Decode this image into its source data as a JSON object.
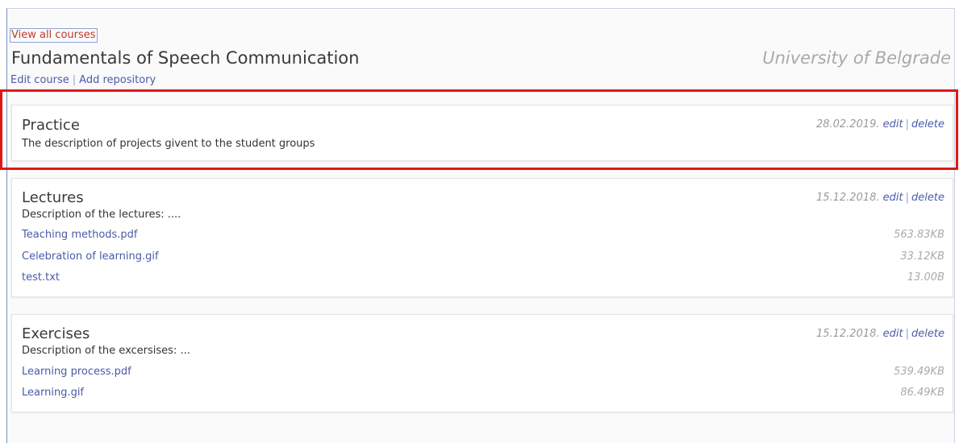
{
  "header": {
    "view_all_label": "View all courses",
    "course_title": "Fundamentals of Speech Communication",
    "university": "University of Belgrade",
    "edit_course_label": "Edit course",
    "add_repository_label": "Add repository",
    "separator": "|"
  },
  "repositories": [
    {
      "title": "Practice",
      "description": "The description of projects givent to the student groups",
      "date": "28.02.2019.",
      "edit_label": "edit",
      "delete_label": "delete",
      "files": []
    },
    {
      "title": "Lectures",
      "description": "Description of the lectures: ....",
      "date": "15.12.2018.",
      "edit_label": "edit",
      "delete_label": "delete",
      "files": [
        {
          "name": "Teaching methods.pdf",
          "size": "563.83KB"
        },
        {
          "name": "Celebration of learning.gif",
          "size": "33.12KB"
        },
        {
          "name": "test.txt",
          "size": "13.00B"
        }
      ]
    },
    {
      "title": "Exercises",
      "description": "Description of the excersises: ...",
      "date": "15.12.2018.",
      "edit_label": "edit",
      "delete_label": "delete",
      "files": [
        {
          "name": "Learning process.pdf",
          "size": "539.49KB"
        },
        {
          "name": "Learning.gif",
          "size": "86.49KB"
        }
      ]
    }
  ],
  "colors": {
    "link": "#4a5aa8",
    "highlight": "#e01818",
    "view_all_text": "#c0392b"
  }
}
